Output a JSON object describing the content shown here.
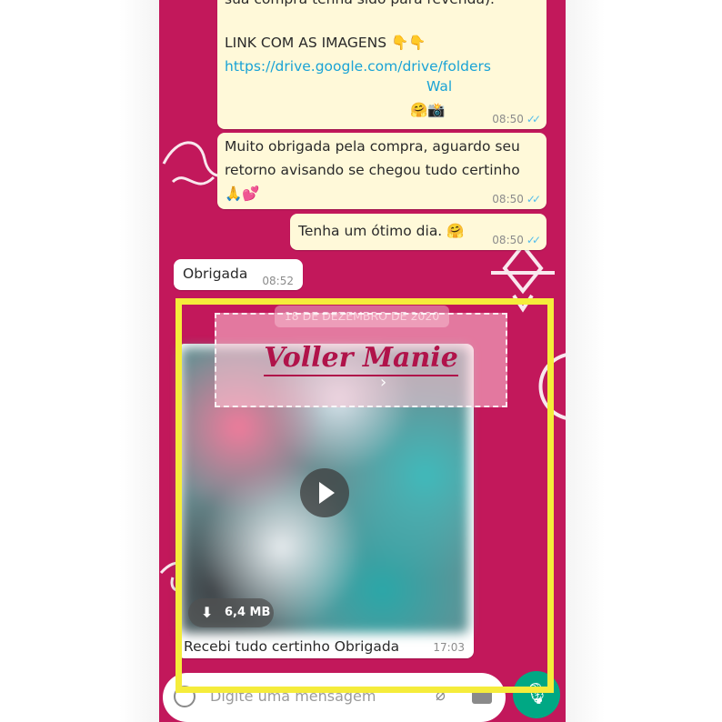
{
  "chat": {
    "msg1": {
      "line0": "sua compra tenha sido para revenda).",
      "link_heading": "LINK COM AS IMAGENS 👇👇",
      "link_url": "https://drive.google.com/drive/folders",
      "name_fragment": "Wal",
      "emojis": "🤗📸",
      "time": "08:50"
    },
    "msg2": {
      "text": "Muito obrigada pela compra, aguardo seu\nretorno avisando se chegou tudo certinho\n🙏💕",
      "time": "08:50"
    },
    "msg3": {
      "text": "Tenha um ótimo dia. 🤗",
      "time": "08:50"
    },
    "msg4": {
      "text": "Obrigada",
      "time": "08:52"
    },
    "date_chip": "18 DE DEZEMBRO DE 2020",
    "watermark_brand": "Voller Manie",
    "video": {
      "size": "6,4 MB",
      "caption": "Recebi tudo certinho Obrigada",
      "time": "17:03"
    }
  },
  "input": {
    "placeholder": "Digite uma mensagem"
  },
  "colors": {
    "chat_bg": "#c2185b",
    "outgoing": "#fff9d9",
    "highlight": "#f5ec3b",
    "send": "#00a884",
    "read_ticks": "#53bdeb"
  },
  "icons": [
    "emoji-icon",
    "attach-icon",
    "camera-icon",
    "mic-icon",
    "play-icon",
    "download-icon",
    "double-check-icon"
  ]
}
